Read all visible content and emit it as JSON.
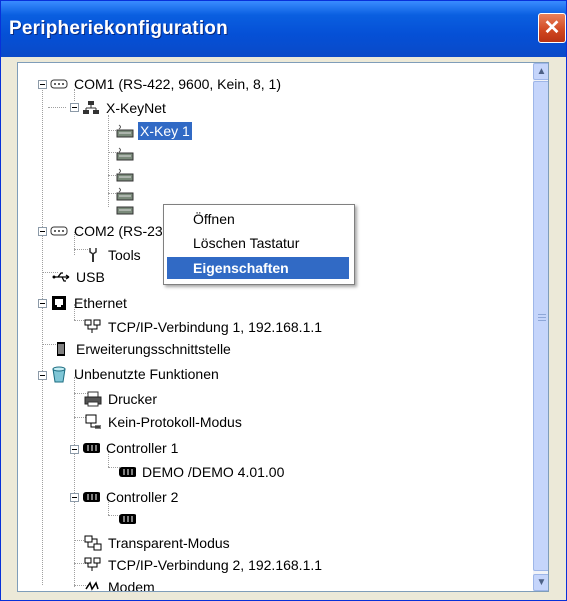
{
  "window": {
    "title": "Peripheriekonfiguration",
    "close_symbol": "✕"
  },
  "tree": {
    "com1": "COM1  (RS-422, 9600, Kein, 8, 1)",
    "xkeynet": "X-KeyNet",
    "xkey1": "X-Key 1",
    "com2": "COM2  (RS-232C, 9600, Kein, 8, 1)",
    "tools": "Tools",
    "usb": "USB",
    "ethernet": "Ethernet",
    "tcpip1": "TCP/IP-Verbindung 1, 192.168.1.1",
    "erweiterung": "Erweiterungsschnittstelle",
    "unbenutzt": "Unbenutzte Funktionen",
    "drucker": "Drucker",
    "keinprotokoll": "Kein-Protokoll-Modus",
    "controller1": "Controller 1",
    "demo": "DEMO /DEMO  4.01.00",
    "controller2": "Controller 2",
    "transparent": "Transparent-Modus",
    "tcpip2": "TCP/IP-Verbindung 2, 192.168.1.1",
    "modem": "Modem"
  },
  "context_menu": {
    "items": [
      "Öffnen",
      "Löschen Tastatur",
      "Eigenschaften"
    ],
    "highlighted": "Eigenschaften"
  },
  "colors": {
    "titlebar": "#0550d6",
    "selection": "#316ac5",
    "close_button": "#d0461f"
  }
}
